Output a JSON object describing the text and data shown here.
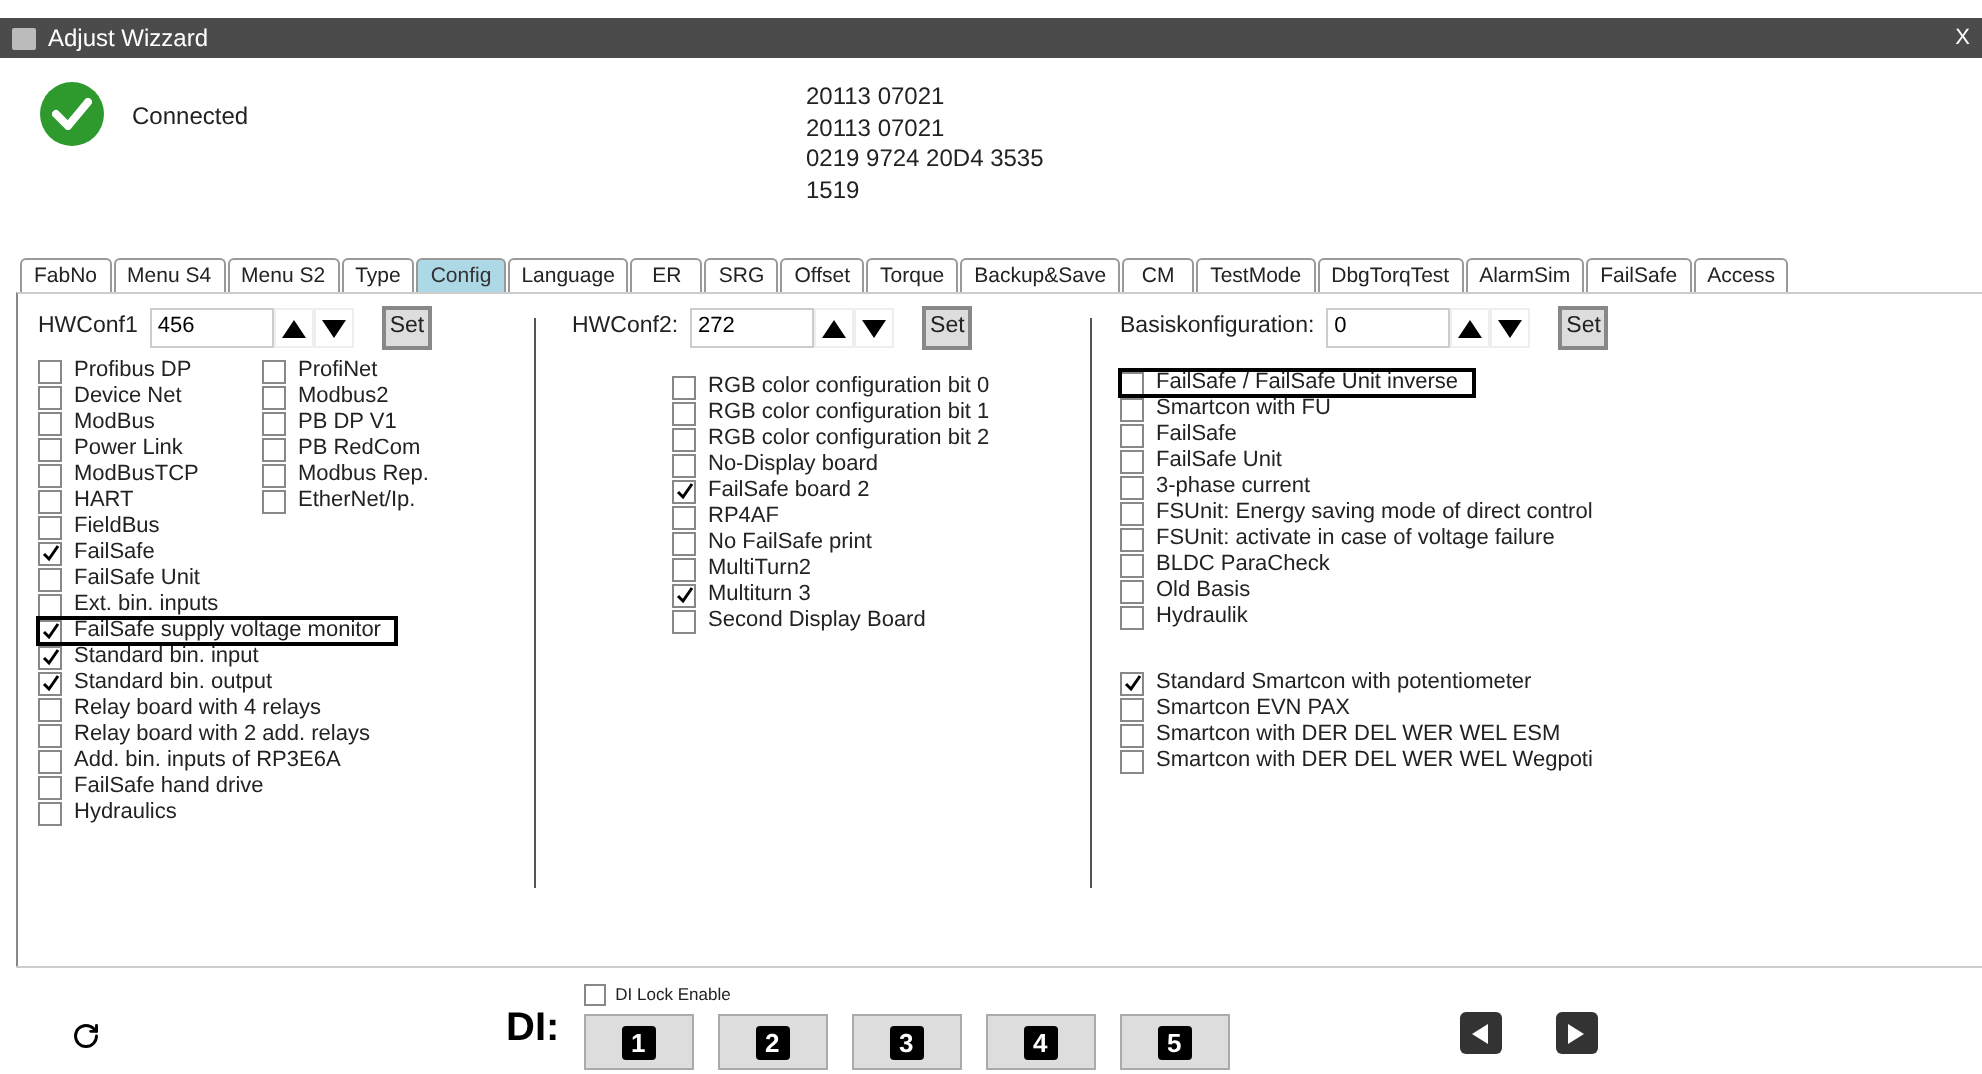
{
  "window": {
    "title": "Adjust Wizzard",
    "close": "X"
  },
  "header": {
    "status": "Connected",
    "connected": true,
    "info": [
      "20113 07021",
      "20113 07021",
      "0219 9724 20D4 3535",
      "1519"
    ]
  },
  "tabs": [
    {
      "label": "FabNo",
      "selected": false
    },
    {
      "label": "Menu S4",
      "selected": false
    },
    {
      "label": "Menu S2",
      "selected": false
    },
    {
      "label": "Type",
      "selected": false
    },
    {
      "label": "Config",
      "selected": true
    },
    {
      "label": "Language",
      "selected": false
    },
    {
      "label": "ER",
      "selected": false
    },
    {
      "label": "SRG",
      "selected": false
    },
    {
      "label": "Offset",
      "selected": false
    },
    {
      "label": "Torque",
      "selected": false
    },
    {
      "label": "Backup&Save",
      "selected": false
    },
    {
      "label": "CM",
      "selected": false
    },
    {
      "label": "TestMode",
      "selected": false
    },
    {
      "label": "DbgTorqTest",
      "selected": false
    },
    {
      "label": "AlarmSim",
      "selected": false
    },
    {
      "label": "FailSafe",
      "selected": false
    },
    {
      "label": "Access",
      "selected": false
    }
  ],
  "sections": [
    {
      "label": "HWConf1",
      "value": "456",
      "set_button": "Set",
      "groups": [
        [
          {
            "label": "Profibus DP",
            "checked": false,
            "highlighted": false
          },
          {
            "label": "Device  Net",
            "checked": false,
            "highlighted": false
          },
          {
            "label": "ModBus",
            "checked": false,
            "highlighted": false
          },
          {
            "label": "Power Link",
            "checked": false,
            "highlighted": false
          },
          {
            "label": "ModBusTCP",
            "checked": false,
            "highlighted": false
          },
          {
            "label": "HART",
            "checked": false,
            "highlighted": false
          },
          {
            "label": "FieldBus",
            "checked": false,
            "highlighted": false
          },
          {
            "label": "FailSafe",
            "checked": true,
            "highlighted": false
          },
          {
            "label": "FailSafe Unit",
            "checked": false,
            "highlighted": false
          },
          {
            "label": "Ext. bin. inputs",
            "checked": false,
            "highlighted": false
          },
          {
            "label": "FailSafe supply voltage monitor",
            "checked": true,
            "highlighted": true
          },
          {
            "label": "Standard bin. input",
            "checked": true,
            "highlighted": false
          },
          {
            "label": "Standard bin. output",
            "checked": true,
            "highlighted": false
          },
          {
            "label": "Relay board with 4 relays",
            "checked": false,
            "highlighted": false
          },
          {
            "label": "Relay board with 2 add. relays",
            "checked": false,
            "highlighted": false
          },
          {
            "label": "Add. bin. inputs of RP3E6A",
            "checked": false,
            "highlighted": false
          },
          {
            "label": "FailSafe hand drive",
            "checked": false,
            "highlighted": false
          },
          {
            "label": "Hydraulics",
            "checked": false,
            "highlighted": false
          }
        ],
        [
          {
            "label": "ProfiNet",
            "checked": false,
            "highlighted": false
          },
          {
            "label": "Modbus2",
            "checked": false,
            "highlighted": false
          },
          {
            "label": "PB DP V1",
            "checked": false,
            "highlighted": false
          },
          {
            "label": "PB RedCom",
            "checked": false,
            "highlighted": false
          },
          {
            "label": "Modbus Rep.",
            "checked": false,
            "highlighted": false
          },
          {
            "label": "EtherNet/Ip.",
            "checked": false,
            "highlighted": false
          }
        ]
      ]
    },
    {
      "label": "HWConf2:",
      "value": "272",
      "set_button": "Set",
      "groups": [
        [
          {
            "label": "RGB color configuration bit 0",
            "checked": false,
            "highlighted": false
          },
          {
            "label": "RGB color configuration bit 1",
            "checked": false,
            "highlighted": false
          },
          {
            "label": "RGB color configuration bit 2",
            "checked": false,
            "highlighted": false
          },
          {
            "label": "No-Display board",
            "checked": false,
            "highlighted": false
          },
          {
            "label": "FailSafe board 2",
            "checked": true,
            "highlighted": false
          },
          {
            "label": "RP4AF",
            "checked": false,
            "highlighted": false
          },
          {
            "label": "No FailSafe print",
            "checked": false,
            "highlighted": false
          },
          {
            "label": "MultiTurn2",
            "checked": false,
            "highlighted": false
          },
          {
            "label": "Multiturn 3",
            "checked": true,
            "highlighted": false
          },
          {
            "label": "Second Display Board",
            "checked": false,
            "highlighted": false
          }
        ]
      ]
    },
    {
      "label": "Basiskonfiguration:",
      "value": "0",
      "set_button": "Set",
      "groups": [
        [
          {
            "label": "FailSafe / FailSafe Unit inverse",
            "checked": false,
            "highlighted": true
          },
          {
            "label": "Smartcon with FU",
            "checked": false,
            "highlighted": false
          },
          {
            "label": "FailSafe",
            "checked": false,
            "highlighted": false
          },
          {
            "label": "FailSafe Unit",
            "checked": false,
            "highlighted": false
          },
          {
            "label": "3-phase current",
            "checked": false,
            "highlighted": false
          },
          {
            "label": "FSUnit: Energy saving mode of direct control",
            "checked": false,
            "highlighted": false
          },
          {
            "label": "FSUnit: activate in case of voltage failure",
            "checked": false,
            "highlighted": false
          },
          {
            "label": "BLDC ParaCheck",
            "checked": false,
            "highlighted": false
          },
          {
            "label": "Old Basis",
            "checked": false,
            "highlighted": false
          },
          {
            "label": "Hydraulik",
            "checked": false,
            "highlighted": false
          }
        ],
        [
          {
            "label": "Standard Smartcon with potentiometer",
            "checked": true,
            "highlighted": false
          },
          {
            "label": "Smartcon EVN PAX",
            "checked": false,
            "highlighted": false
          },
          {
            "label": "Smartcon with DER DEL WER WEL ESM",
            "checked": false,
            "highlighted": false
          },
          {
            "label": "Smartcon with DER DEL WER WEL Wegpoti",
            "checked": false,
            "highlighted": false
          }
        ]
      ]
    }
  ],
  "footer": {
    "di_label": "DI:",
    "lock": {
      "label": "DI Lock Enable",
      "checked": false
    },
    "keys": [
      "1",
      "2",
      "3",
      "4",
      "5"
    ]
  }
}
